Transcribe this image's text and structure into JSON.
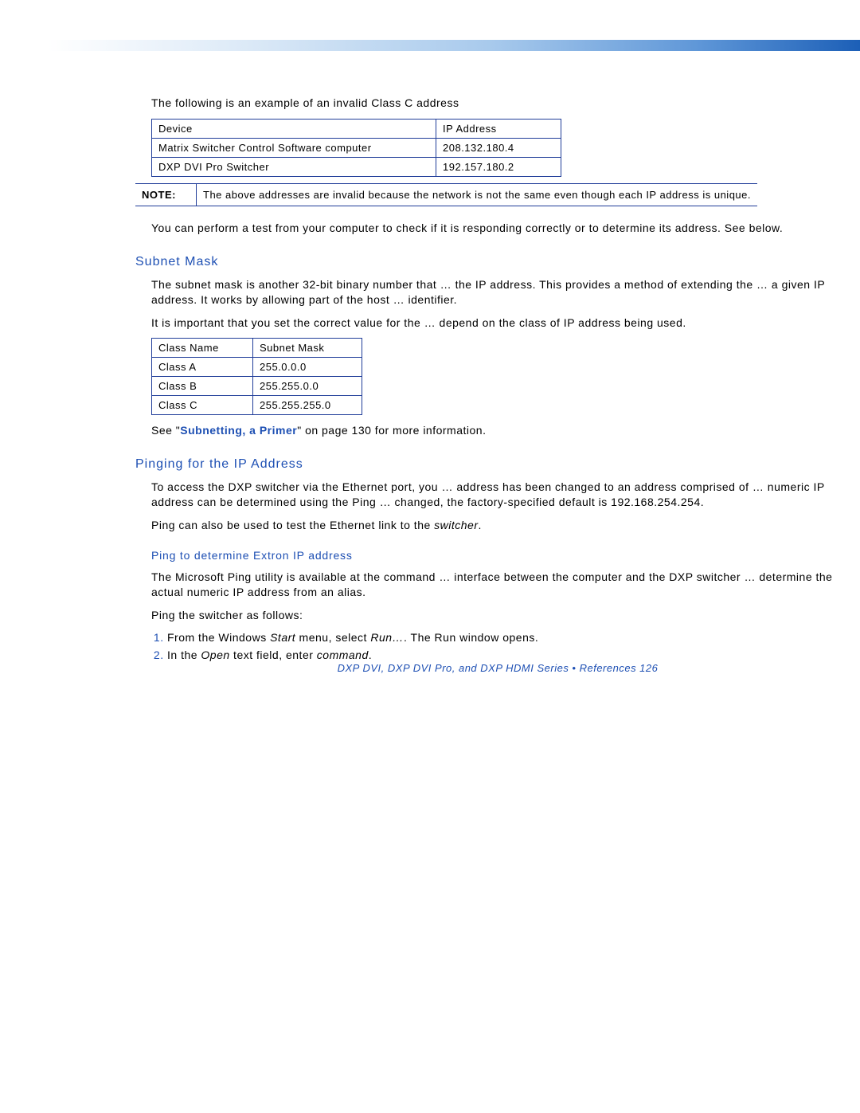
{
  "intro": "The following is an example of an invalid Class C address",
  "table1": {
    "headers": [
      "Device",
      "IP Address"
    ],
    "rows": [
      [
        "Matrix Switcher Control Software computer",
        "208.132.180.4"
      ],
      [
        "DXP DVI Pro Switcher",
        "192.157.180.2"
      ]
    ]
  },
  "note": {
    "label": "NOTE:",
    "text": "The above addresses are invalid because the network is not the same even though each IP address is unique."
  },
  "perform_test": "You can perform a test from your computer to check if it is responding correctly or to determine its address. See below.",
  "h2_subnet": "Subnet Mask",
  "subnet_p1": "The subnet mask is another 32-bit binary number that …  the IP address. This provides a method of extending the …  a given IP address. It works by allowing part of the host …  identifier.",
  "subnet_p2": "It is important that you set the correct value for the …  depend on the class of IP address being used.",
  "table2": {
    "headers": [
      "Class Name",
      "Subnet Mask"
    ],
    "rows": [
      [
        "Class A",
        "255.0.0.0"
      ],
      [
        "Class B",
        "255.255.0.0"
      ],
      [
        "Class C",
        "255.255.255.0"
      ]
    ]
  },
  "see_prefix": "See \"",
  "see_link": "Subnetting, a Primer",
  "see_suffix": "\" on page 130 for more information.",
  "h2_ping": "Pinging for the IP Address",
  "ping_p1": "To access the DXP switcher via the Ethernet port, you …  address has been changed to an address comprised of …  numeric IP address can be determined using the Ping …  changed, the factory-specified default is 192.168.254.254.",
  "ping_p2_a": "Ping can also be used to test the Ethernet link to the ",
  "ping_p2_link": "switcher",
  "ping_p2_b": ".",
  "h3_ping_det": "Ping to determine Extron IP address",
  "ping_det_p1": "The Microsoft Ping utility is available at the command …  interface between the computer and the DXP switcher …  determine the actual numeric IP address from an alias.",
  "ping_instr": "Ping the switcher as follows:",
  "steps": [
    {
      "a": "From the Windows ",
      "b": "Start",
      "c": " menu, select ",
      "d": "Run…",
      "e": ". The Run window opens."
    },
    {
      "a": "In the ",
      "b": "Open",
      "c": " text field, enter ",
      "d": "command",
      "e": "."
    }
  ],
  "footer": "DXP DVI, DXP DVI Pro, and DXP HDMI Series • References  126"
}
